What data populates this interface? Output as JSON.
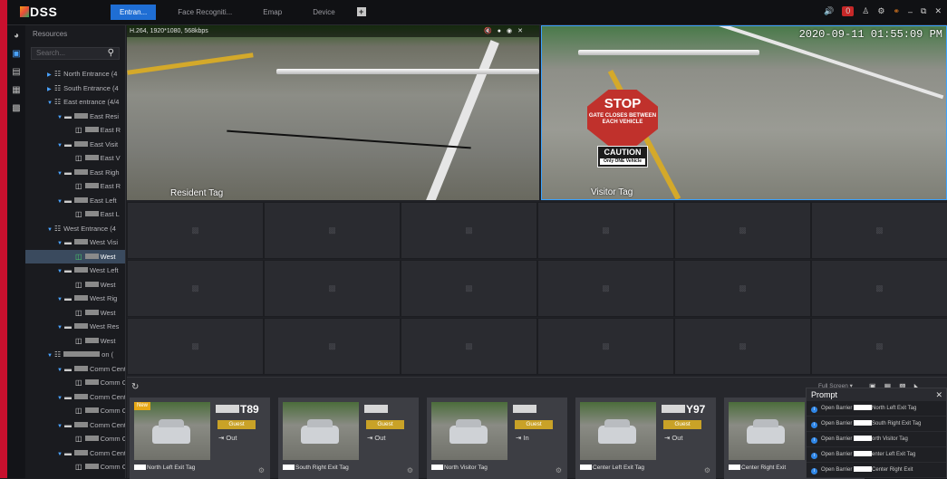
{
  "app": {
    "name": "DSS",
    "logo_icon": "dss-logo-icon"
  },
  "tabs": [
    {
      "label": "Entran...",
      "active": true
    },
    {
      "label": "Face Recogniti...",
      "active": false
    },
    {
      "label": "Emap",
      "active": false
    },
    {
      "label": "Device",
      "active": false
    }
  ],
  "window_controls": {
    "alarm_count": "0"
  },
  "sidebar": {
    "title": "Resources",
    "search_placeholder": "Search...",
    "tree": [
      {
        "label": "North Entrance (4",
        "level": 1,
        "type": "group"
      },
      {
        "label": "South Entrance (4",
        "level": 1,
        "type": "group"
      },
      {
        "label": "East entrance (4/4",
        "level": 1,
        "type": "group"
      },
      {
        "label": "East Resi",
        "level": 2,
        "type": "device"
      },
      {
        "label": "East R",
        "level": 3,
        "type": "channel"
      },
      {
        "label": "East Visit",
        "level": 2,
        "type": "device"
      },
      {
        "label": "East V",
        "level": 3,
        "type": "channel"
      },
      {
        "label": "East Righ",
        "level": 2,
        "type": "device"
      },
      {
        "label": "East R",
        "level": 3,
        "type": "channel"
      },
      {
        "label": "East Left",
        "level": 2,
        "type": "device"
      },
      {
        "label": "East L",
        "level": 3,
        "type": "channel"
      },
      {
        "label": "West  Entrance (4",
        "level": 1,
        "type": "group"
      },
      {
        "label": "West Visi",
        "level": 2,
        "type": "device"
      },
      {
        "label": "West",
        "level": 3,
        "type": "channel",
        "selected": true
      },
      {
        "label": "West Left",
        "level": 2,
        "type": "device"
      },
      {
        "label": "West",
        "level": 3,
        "type": "channel"
      },
      {
        "label": "West Rig",
        "level": 2,
        "type": "device"
      },
      {
        "label": "West",
        "level": 3,
        "type": "channel"
      },
      {
        "label": "West Res",
        "level": 2,
        "type": "device"
      },
      {
        "label": "West",
        "level": 3,
        "type": "channel"
      },
      {
        "label": "on (",
        "level": 1,
        "type": "group"
      },
      {
        "label": "Comm Center",
        "level": 2,
        "type": "device"
      },
      {
        "label": "Comm Cer",
        "level": 3,
        "type": "channel"
      },
      {
        "label": "Comm Center",
        "level": 2,
        "type": "device"
      },
      {
        "label": "Comm Cen",
        "level": 3,
        "type": "channel"
      },
      {
        "label": "Comm Center",
        "level": 2,
        "type": "device"
      },
      {
        "label": "Comm Cer",
        "level": 3,
        "type": "channel"
      },
      {
        "label": "Comm Center",
        "level": 2,
        "type": "device"
      },
      {
        "label": "Comm Cer",
        "level": 3,
        "type": "channel"
      }
    ]
  },
  "video": {
    "info": "H.264, 1920*1080, 568kbps",
    "left_label": "Resident Tag",
    "right_label": "Visitor Tag",
    "timestamp": "2020-09-11 01:55:09 PM",
    "sign_stop": "STOP",
    "sign_stop_sub": "GATE CLOSES BETWEEN EACH VEHICLE",
    "sign_caution": "CAUTION",
    "sign_caution_sub": "Only ONE Vehicle"
  },
  "layout_select": {
    "value": "Full Screen"
  },
  "events": [
    {
      "plate": "T89",
      "badge": "Guest",
      "direction": "Out",
      "location": "North Left Exit Tag",
      "is_new": true,
      "new_label": "New"
    },
    {
      "plate": "",
      "badge": "Guest",
      "direction": "Out",
      "location": "South Right Exit Tag",
      "is_new": false
    },
    {
      "plate": "",
      "badge": "Guest",
      "direction": "In",
      "location": "North Visitor Tag",
      "is_new": false
    },
    {
      "plate": "Y97",
      "badge": "Guest",
      "direction": "Out",
      "location": "Center Left Exit Tag",
      "is_new": false
    },
    {
      "plate": "",
      "badge": "",
      "direction": "",
      "location": "Center Right Exit",
      "is_new": false
    }
  ],
  "prompt": {
    "title": "Prompt",
    "rows": [
      {
        "prefix": "Open Barrier",
        "text": "North Left Exit Tag"
      },
      {
        "prefix": "Open Barrier",
        "text": "South Right Exit Tag"
      },
      {
        "prefix": "Open Barrier",
        "text": "orth Visitor Tag"
      },
      {
        "prefix": "Open Barrier",
        "text": "enter Left Exit Tag"
      },
      {
        "prefix": "Open Barrier",
        "text": "Center Right Exit"
      }
    ]
  }
}
